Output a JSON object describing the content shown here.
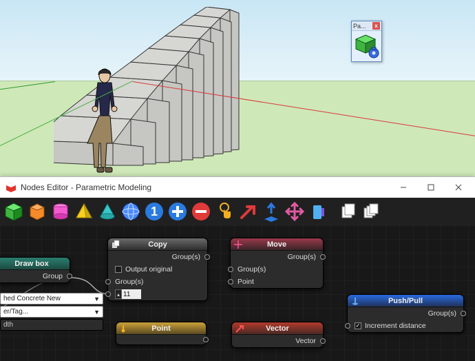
{
  "floatPanel": {
    "title": "Pa..."
  },
  "window": {
    "title": "Nodes Editor - Parametric Modeling"
  },
  "sideFields": {
    "material": "hed Concrete New",
    "tag": "er/Tag...",
    "width": "dth"
  },
  "nodes": {
    "drawbox": {
      "title": "Draw box",
      "out_group": "Group"
    },
    "copy": {
      "title": "Copy",
      "out_groups": "Group(s)",
      "output_original": "Output original",
      "in_groups": "Group(s)",
      "num_value": "11"
    },
    "move": {
      "title": "Move",
      "out_groups": "Group(s)",
      "in_groups": "Group(s)",
      "in_point": "Point"
    },
    "point": {
      "title": "Point"
    },
    "vector": {
      "title": "Vector",
      "out": "Vector"
    },
    "push": {
      "title": "Push/Pull",
      "out_groups": "Group(s)",
      "increment": "Increment distance"
    }
  },
  "icons": {
    "cube_green": "cube",
    "hex_orange": "hex",
    "cyl_pink": "cylinder",
    "pyr_yellow": "pyramid",
    "cone_teal": "cone",
    "sphere_blue": "sphere",
    "one": "number-one",
    "plus": "add",
    "minus": "subtract",
    "touch": "touch",
    "arrow": "arrow",
    "extrude": "extrude",
    "move": "move-arrows",
    "box": "box",
    "copydoc": "copy-doc",
    "multidoc": "multi-doc"
  }
}
